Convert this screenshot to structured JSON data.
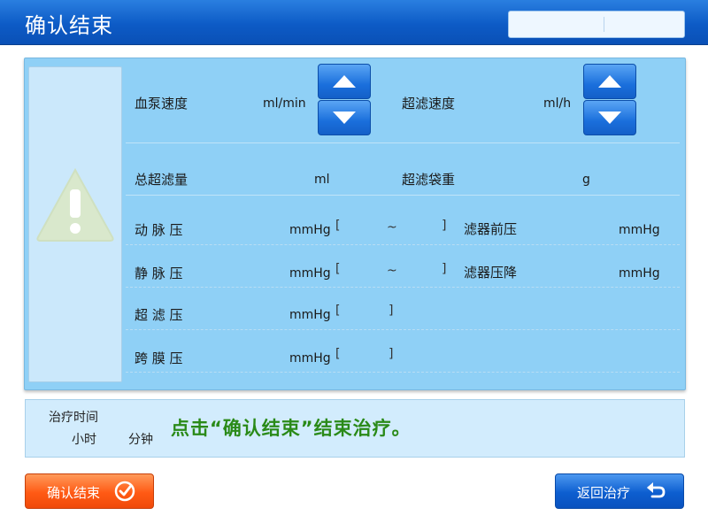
{
  "header": {
    "title": "确认结束"
  },
  "params": {
    "blood_pump_speed": {
      "label": "血泵速度",
      "unit": "ml/min"
    },
    "uf_speed": {
      "label": "超滤速度",
      "unit": "ml/h"
    },
    "total_uf": {
      "label": "总超滤量",
      "unit": "ml"
    },
    "uf_bag_weight": {
      "label": "超滤袋重",
      "unit": "g"
    },
    "arterial_pressure": {
      "label": "动 脉 压",
      "unit": "mmHg",
      "range_sep": "~"
    },
    "venous_pressure": {
      "label": "静 脉 压",
      "unit": "mmHg",
      "range_sep": "~"
    },
    "uf_pressure": {
      "label": "超 滤 压",
      "unit": "mmHg"
    },
    "tmp": {
      "label": "跨 膜 压",
      "unit": "mmHg"
    },
    "pre_filter_pressure": {
      "label": "滤器前压",
      "unit": "mmHg"
    },
    "filter_pressure_drop": {
      "label": "滤器压降",
      "unit": "mmHg"
    }
  },
  "info": {
    "treatment_time_label": "治疗时间",
    "hours_unit": "小时",
    "minutes_unit": "分钟",
    "message": "点击“确认结束”结束治疗。"
  },
  "buttons": {
    "confirm_label": "确认结束",
    "back_label": "返回治疗"
  },
  "colors": {
    "header_blue": "#0d5bc6",
    "panel_blue": "#8fd0f6",
    "confirm_orange": "#ff5a14",
    "message_green": "#2a8a18"
  }
}
